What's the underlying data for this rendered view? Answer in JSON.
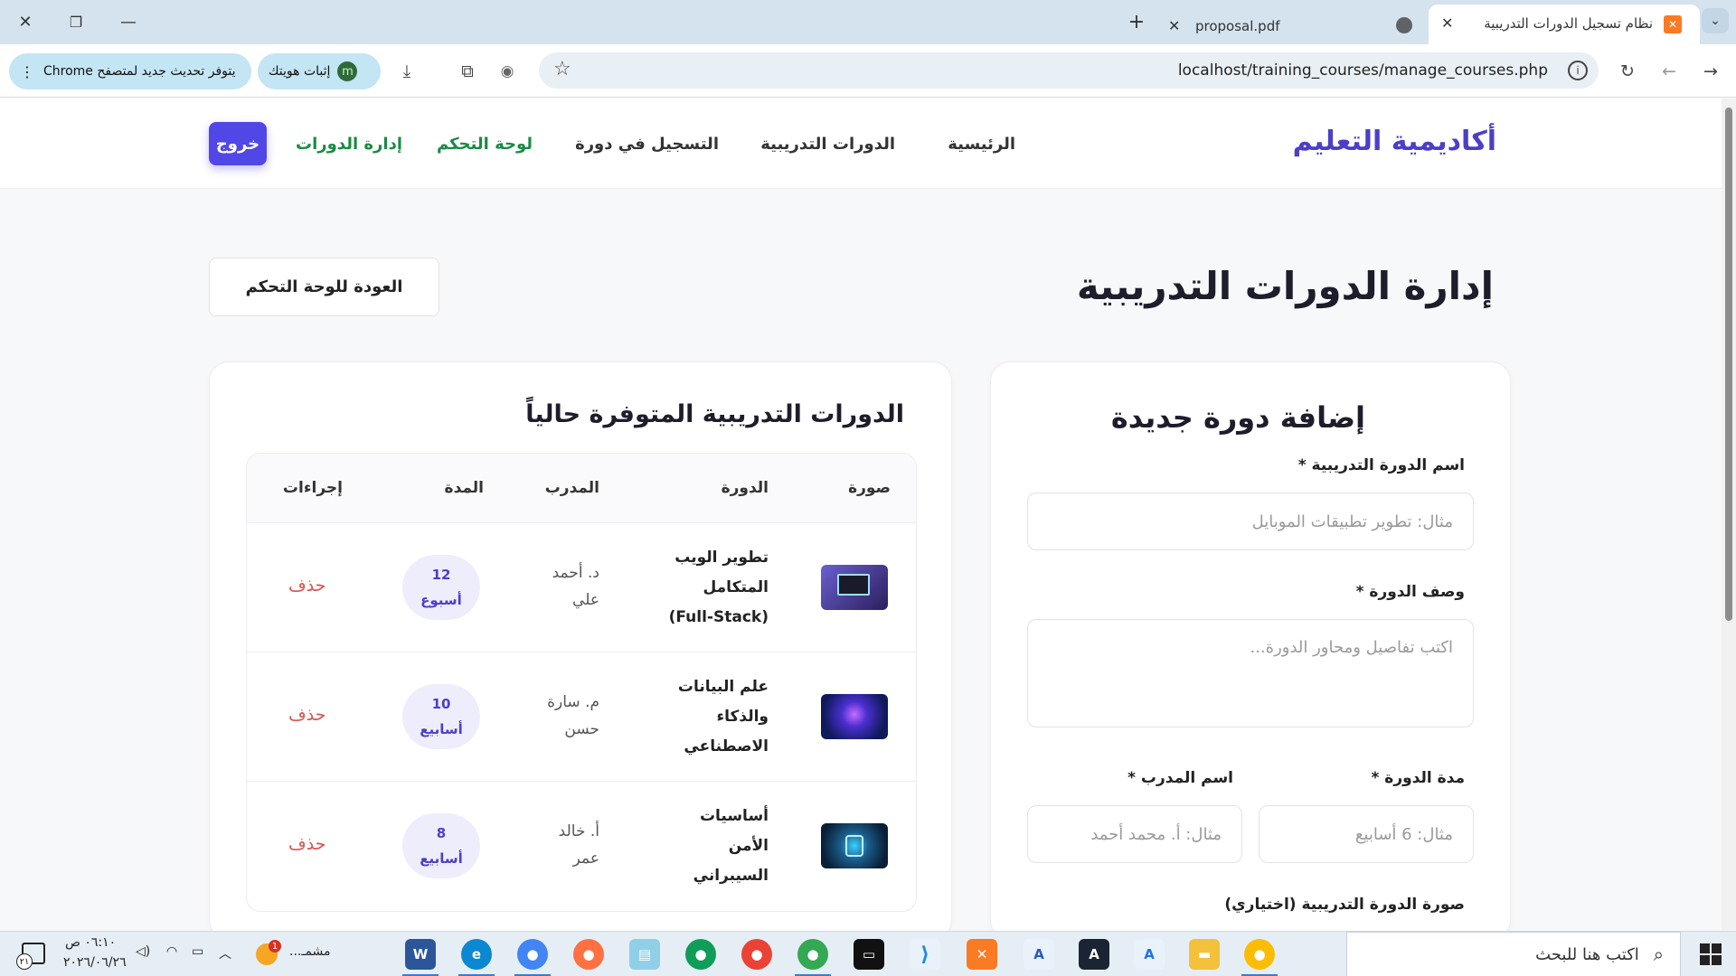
{
  "browser": {
    "tabs": [
      {
        "title": "نظام تسجيل الدورات التدريبية",
        "active": true
      },
      {
        "title": "proposal.pdf",
        "active": false
      }
    ],
    "url": "localhost/training_courses/manage_courses.php",
    "update_pill": "يتوفر تحديث جديد لمتصفح Chrome",
    "identity_pill": "إثبات هويتك",
    "identity_avatar": "m"
  },
  "site": {
    "brand": "أكاديمية التعليم",
    "nav": {
      "home": "الرئيسية",
      "courses": "الدورات التدريبية",
      "register": "التسجيل في دورة",
      "dashboard": "لوحة التحكم",
      "manage": "إدارة الدورات",
      "logout": "خروج"
    }
  },
  "page": {
    "title": "إدارة الدورات التدريبية",
    "back_button": "العودة للوحة التحكم"
  },
  "courses_card": {
    "heading": "الدورات التدريبية المتوفرة حالياً",
    "columns": {
      "image": "صورة",
      "course": "الدورة",
      "trainer": "المدرب",
      "duration": "المدة",
      "actions": "إجراءات"
    },
    "rows": [
      {
        "name": "تطوير الويب المتكامل (Full-Stack)",
        "trainer": "د. أحمد علي",
        "duration_num": "12",
        "duration_unit": "أسبوع",
        "delete": "حذف",
        "thumb_color": "#3a2f7a"
      },
      {
        "name": "علم البيانات والذكاء الاصطناعي",
        "trainer": "م. سارة حسن",
        "duration_num": "10",
        "duration_unit": "أسابيع",
        "delete": "حذف",
        "thumb_color": "#1a2a7a"
      },
      {
        "name": "أساسيات الأمن السيبراني",
        "trainer": "أ. خالد عمر",
        "duration_num": "8",
        "duration_unit": "أسابيع",
        "delete": "حذف",
        "thumb_color": "#0d4a6a"
      }
    ]
  },
  "form_card": {
    "heading": "إضافة دورة جديدة",
    "name_label": "اسم الدورة التدريبية *",
    "name_placeholder": "مثال: تطوير تطبيقات الموبايل",
    "desc_label": "وصف الدورة *",
    "desc_placeholder": "اكتب تفاصيل ومحاور الدورة...",
    "duration_label": "مدة الدورة *",
    "duration_placeholder": "مثال: 6 أسابيع",
    "trainer_label": "اسم المدرب *",
    "trainer_placeholder": "مثال: أ. محمد أحمد",
    "image_label": "صورة الدورة التدريبية (اختياري)"
  },
  "taskbar": {
    "search_placeholder": "اكتب هنا للبحث",
    "time": "٠٦:١٠ ص",
    "date": "٢٠٢٦/٠٦/٢٦",
    "weather_label": "مشمـ...",
    "notif_count": "1",
    "notif_badge": "٢١"
  },
  "colors": {
    "brand": "#4b3fc8",
    "accent_green": "#1a8a44",
    "logout_bg": "#5147e6",
    "delete_red": "#d9534f"
  }
}
